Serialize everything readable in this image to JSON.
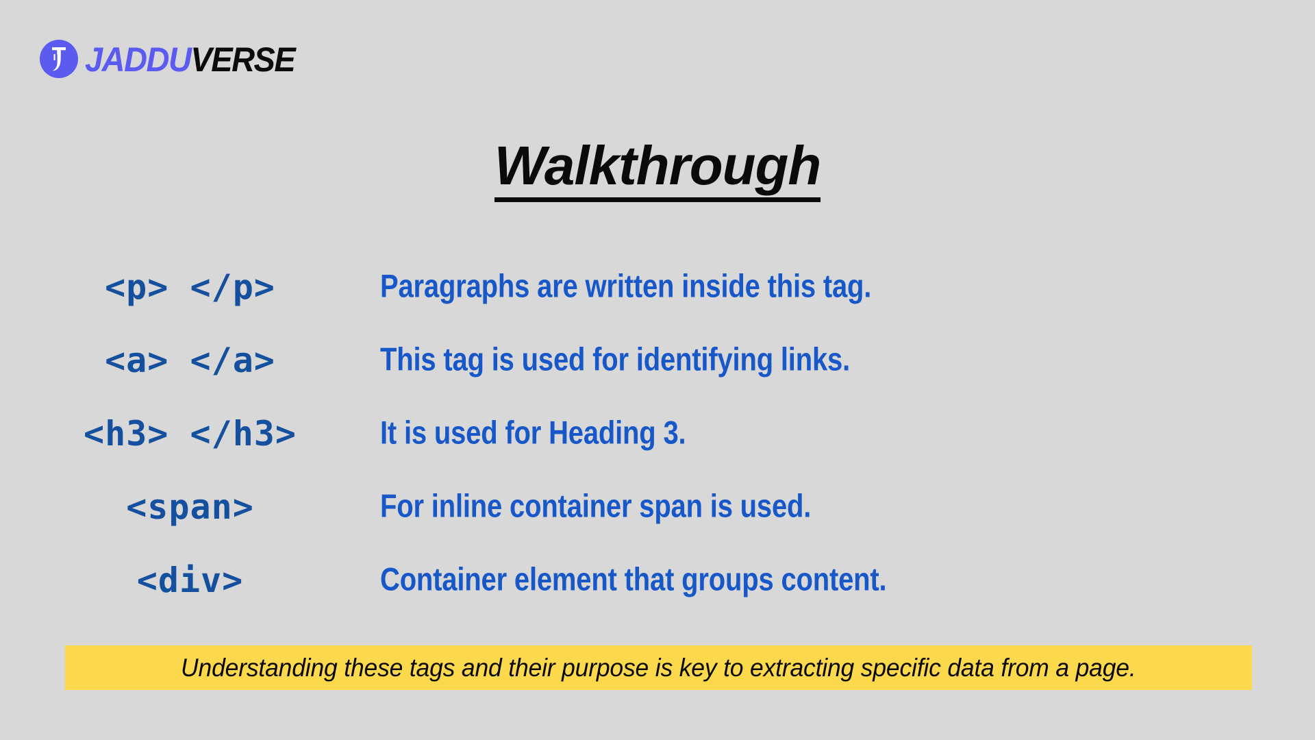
{
  "colors": {
    "background": "#d8d8d8",
    "brand_purple": "#5b5bf0",
    "brand_black": "#0b0b0b",
    "code_blue": "#14509e",
    "desc_blue": "#1757c8",
    "callout_yellow": "#fcd84d",
    "title_black": "#0a0a0a"
  },
  "brand": {
    "icon": "jadduverse-logo-icon",
    "name_part_one": "JADDU",
    "name_part_two": "VERSE"
  },
  "title": "Walkthrough",
  "tag_table": {
    "rows": [
      {
        "code": "<p> </p>",
        "description": "Paragraphs are written inside this tag."
      },
      {
        "code": "<a> </a>",
        "description": "This tag is used for identifying links."
      },
      {
        "code": "<h3> </h3>",
        "description": "It is used for Heading 3."
      },
      {
        "code": "<span>",
        "description": "For inline container span is used."
      },
      {
        "code": "<div>",
        "description": "Container element that groups content."
      }
    ]
  },
  "callout": {
    "text": "Understanding these tags and their purpose is key to extracting specific data from a page."
  }
}
